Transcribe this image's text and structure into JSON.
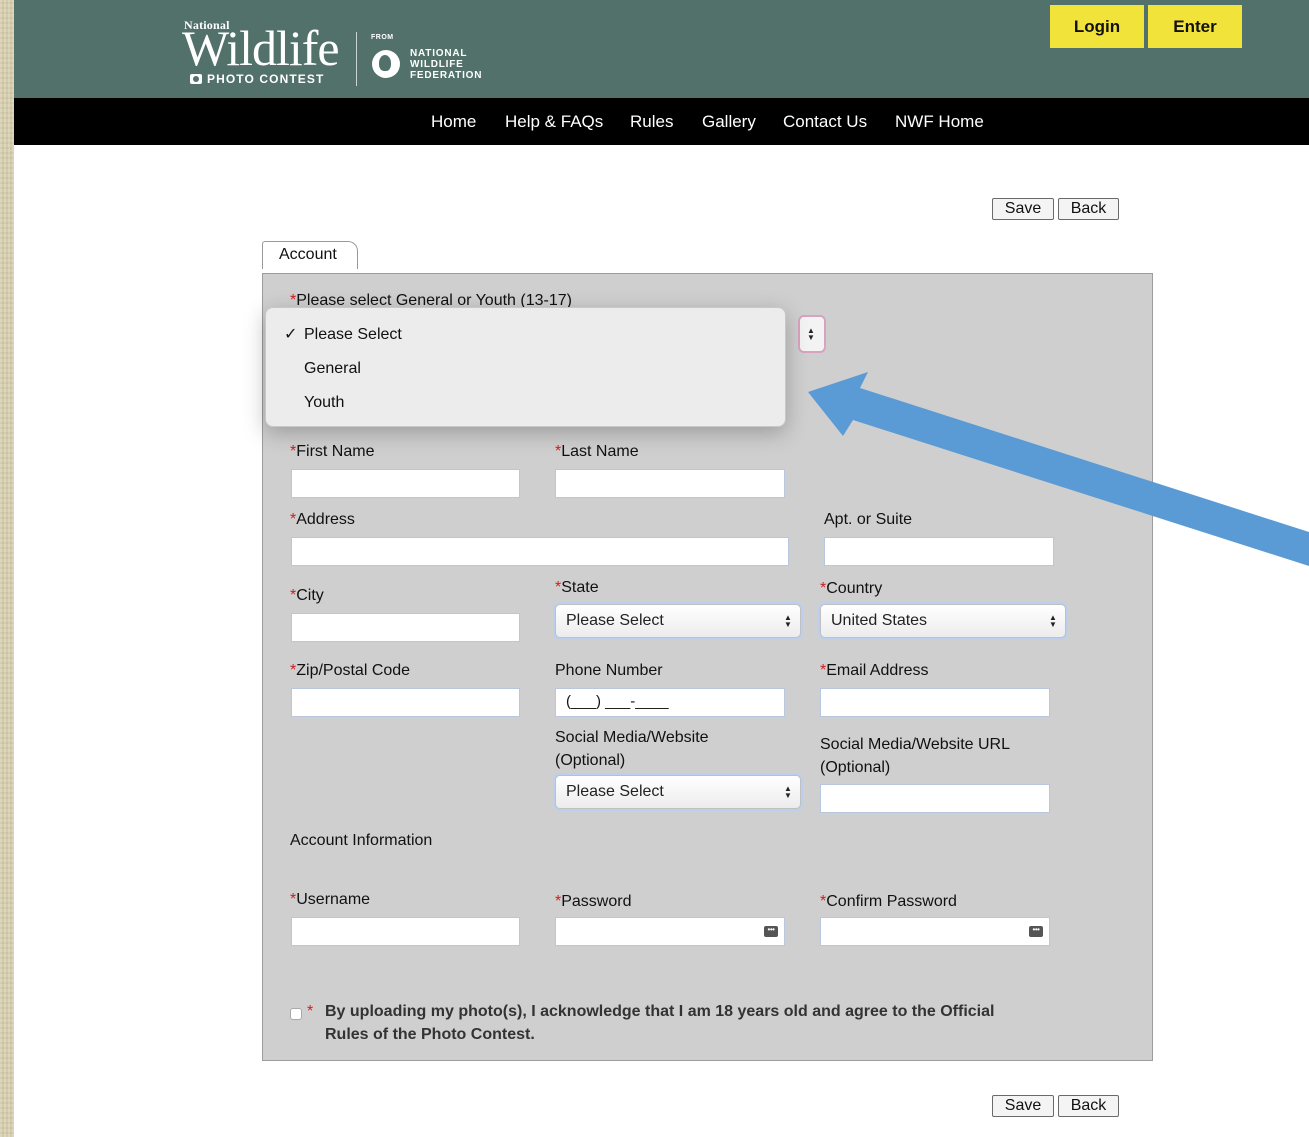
{
  "header": {
    "logo": {
      "national": "National",
      "wildlife": "Wildlife",
      "photo_contest": "PHOTO CONTEST",
      "from": "FROM",
      "nwf_line1": "NATIONAL",
      "nwf_line2": "WILDLIFE",
      "nwf_line3": "FEDERATION"
    },
    "login_label": "Login",
    "enter_label": "Enter",
    "colors": {
      "header_bg": "#51716a",
      "cta_bg": "#f2e33b",
      "nav_bg": "#000000"
    }
  },
  "nav": {
    "items": [
      "Home",
      "Help & FAQs",
      "Rules",
      "Gallery",
      "Contact Us",
      "NWF Home"
    ]
  },
  "actions": {
    "save_label": "Save",
    "back_label": "Back"
  },
  "tabs": {
    "account_label": "Account"
  },
  "form": {
    "required_mark": "*",
    "category": {
      "label": "Please select General or Youth (13-17)",
      "options": [
        "Please Select",
        "General",
        "Youth"
      ],
      "selected": "Please Select",
      "check": "✓"
    },
    "first_name": {
      "label": "First Name",
      "value": ""
    },
    "last_name": {
      "label": "Last Name",
      "value": ""
    },
    "address": {
      "label": "Address",
      "value": ""
    },
    "apt": {
      "label": "Apt. or Suite",
      "value": ""
    },
    "city": {
      "label": "City",
      "value": ""
    },
    "state": {
      "label": "State",
      "selected": "Please Select"
    },
    "country": {
      "label": "Country",
      "selected": "United States"
    },
    "zip": {
      "label": "Zip/Postal Code",
      "value": ""
    },
    "phone": {
      "label": "Phone Number",
      "value": "(___) ___-____"
    },
    "email": {
      "label": "Email Address",
      "value": ""
    },
    "social_type": {
      "label_line1": "Social Media/Website",
      "label_line2": "(Optional)",
      "selected": "Please Select"
    },
    "social_url": {
      "label_line1": "Social Media/Website URL",
      "label_line2": "(Optional)",
      "value": ""
    },
    "account_info_heading": "Account Information",
    "username": {
      "label": "Username",
      "value": ""
    },
    "password": {
      "label": "Password",
      "value": ""
    },
    "confirm_password": {
      "label": "Confirm Password",
      "value": ""
    },
    "agree": {
      "line1": "By uploading my photo(s), I acknowledge that I am 18 years old and agree to the Official",
      "line2": "Rules of the Photo Contest.",
      "checked": false
    }
  },
  "annotation": {
    "arrow_color": "#5b9bd5"
  }
}
